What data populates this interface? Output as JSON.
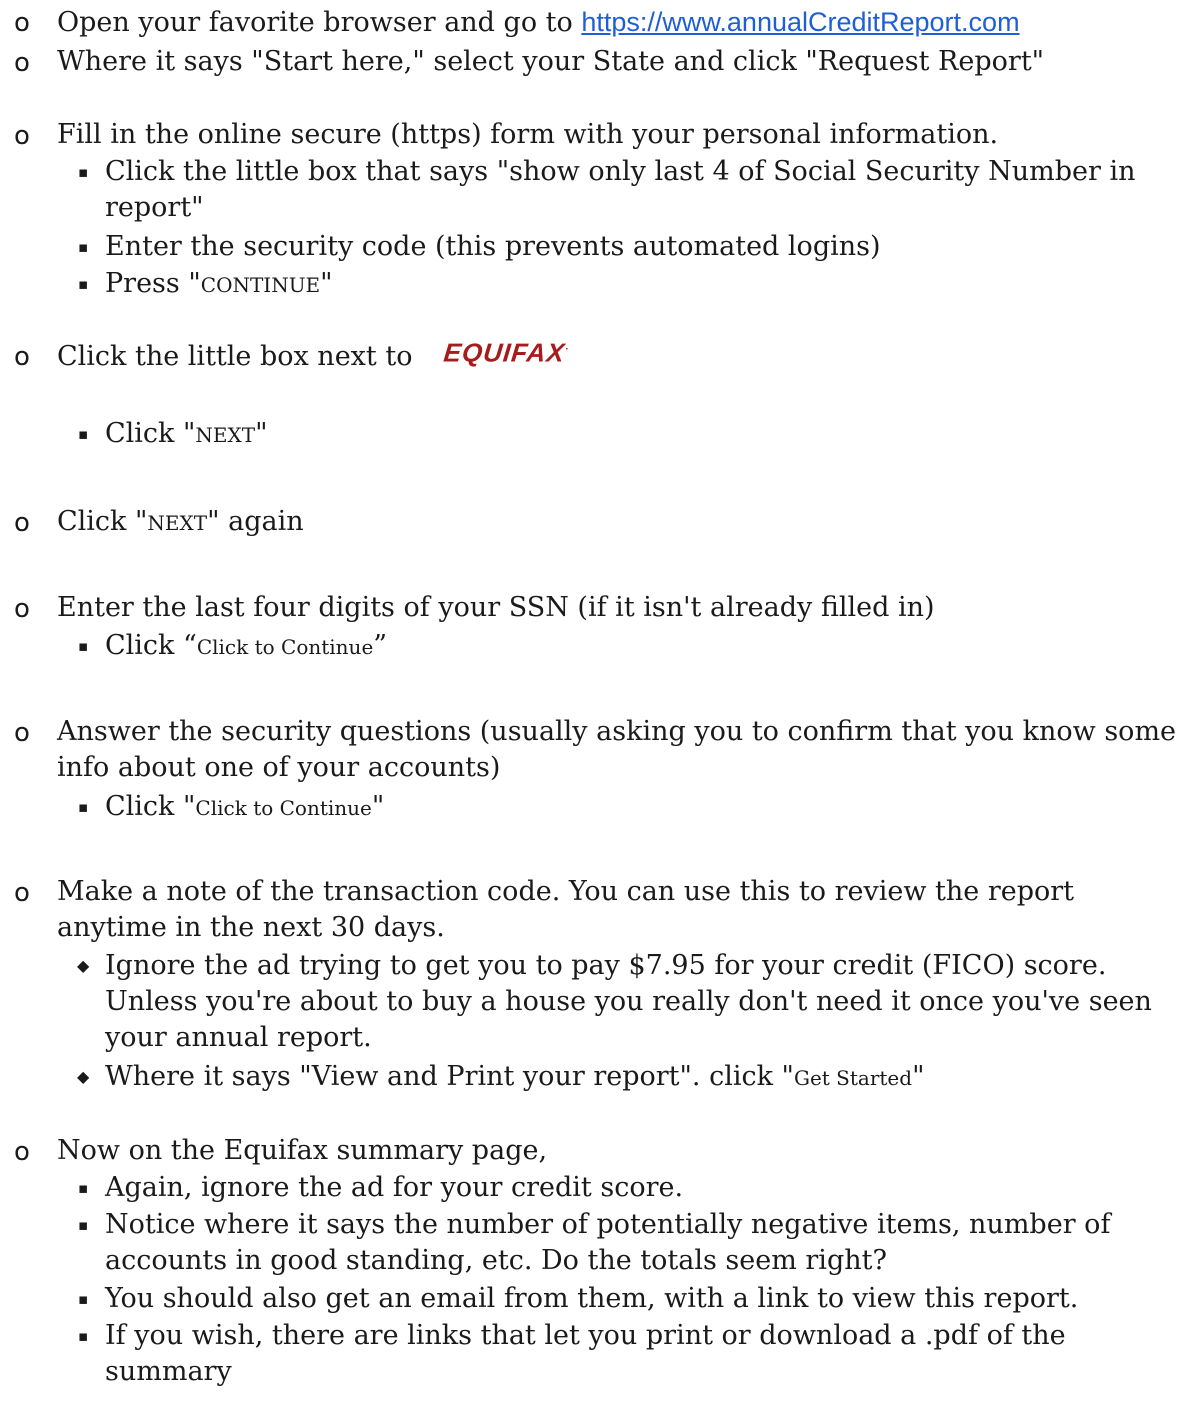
{
  "markers": {
    "circle": "o",
    "square": "▪",
    "diamond": "◆"
  },
  "steps": {
    "s1": {
      "prefix": "Open  your favorite browser and go to ",
      "link": "https://www.annualCreditReport.com"
    },
    "s2": "Where it says \"Start here,\" select your State and click \"Request Report\"",
    "s3": "Fill in the online secure (https) form with your personal information.",
    "s3a": "Click the little box that says \"show only last 4 of Social Security Number in report\"",
    "s3b": "Enter the security code (this prevents automated logins)",
    "s3c": {
      "prefix": "Press \"",
      "label": "CONTINUE",
      "suffix": "\""
    },
    "s4": {
      "prefix": "Click the little box next to",
      "logo": "EQUIFAX",
      "logo_mark": "·"
    },
    "s4a": {
      "prefix": "Click \"",
      "label": "NEXT",
      "suffix": "\""
    },
    "s5": {
      "prefix": "Click \"",
      "label": "NEXT",
      "suffix": "\" again"
    },
    "s6": "Enter the last four digits of your SSN (if it isn't already filled in)",
    "s6a": {
      "prefix": "Click “",
      "label": "Click to Continue",
      "suffix": "”"
    },
    "s7": "Answer the security questions (usually asking you to confirm that you know some info about one of your accounts)",
    "s7a": {
      "prefix": "Click \"",
      "label": "Click to Continue",
      "suffix": "\""
    },
    "s8": "Make a note of the transaction code.  You can use this to review the report anytime in the next 30 days.",
    "s8a": "Ignore the ad trying to get you to pay $7.95 for your credit (FICO) score. Unless you're about to buy a house you really don't need it once you've seen your annual report.",
    "s8b": {
      "prefix": "Where it says \"View and Print your report\". click \"",
      "label": "Get Started",
      "suffix": "\""
    },
    "s9": "Now on the Equifax summary page,",
    "s9a": "Again, ignore the ad for your credit score.",
    "s9b": "Notice where it says the number of potentially negative items, number of accounts in good standing, etc.  Do the totals seem right?",
    "s9c": "You should also get an email from them, with a link to view this report.",
    "s9d": "If you wish, there are links that let you print or download a .pdf of the summary"
  }
}
